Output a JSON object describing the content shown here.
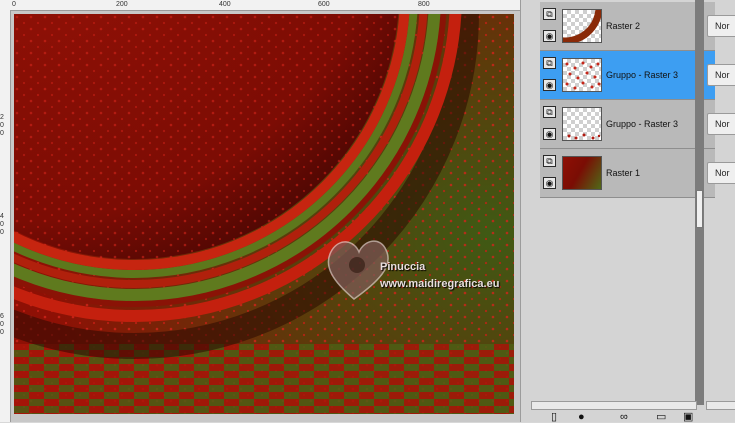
{
  "ruler": {
    "top_labels": [
      "0",
      "200",
      "400",
      "600",
      "800"
    ],
    "left_labels": [
      "2",
      "0",
      "0",
      "4",
      "0",
      "0",
      "6",
      "0",
      "0"
    ]
  },
  "artwork": {
    "watermark_line1": "Pinuccia",
    "watermark_line2": "www.maidiregrafica.eu"
  },
  "layers": [
    {
      "name": "Raster 2",
      "selected": false,
      "blend": "Nor",
      "thumb": "ring-arc"
    },
    {
      "name": "Gruppo - Raster 3",
      "selected": true,
      "blend": "Nor",
      "thumb": "dots"
    },
    {
      "name": "Gruppo - Raster 3",
      "selected": false,
      "blend": "Nor",
      "thumb": "scatter"
    },
    {
      "name": "Raster 1",
      "selected": false,
      "blend": "Nor",
      "thumb": "gradient"
    }
  ],
  "icons": {
    "link": "link-icon",
    "visibility": "eye-icon"
  },
  "colors": {
    "canvas_red": "#8a0f05",
    "ring_green": "#4e6f1a",
    "selection": "#3d9ef2"
  }
}
